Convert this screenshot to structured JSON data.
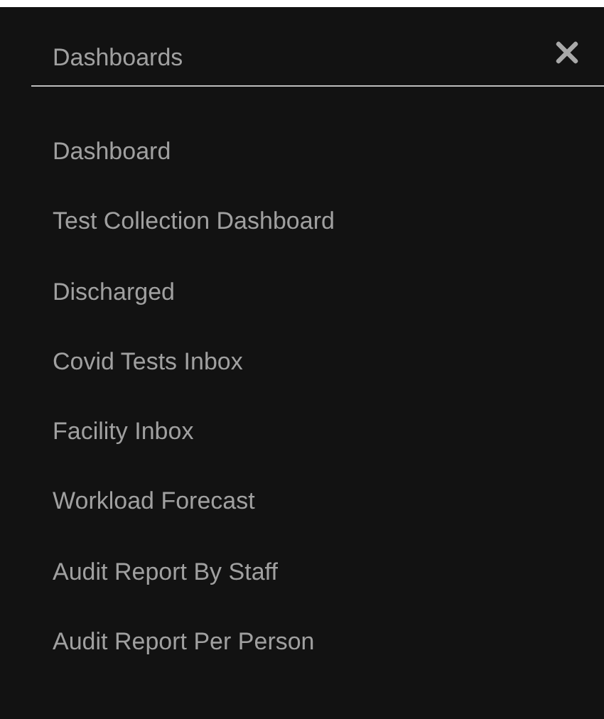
{
  "menu": {
    "title": "Dashboards",
    "items": [
      {
        "label": "Dashboard"
      },
      {
        "label": "Test Collection Dashboard"
      },
      {
        "label": "Discharged"
      },
      {
        "label": "Covid Tests Inbox"
      },
      {
        "label": "Facility Inbox"
      },
      {
        "label": "Workload Forecast"
      },
      {
        "label": "Audit Report By Staff"
      },
      {
        "label": "Audit Report Per Person"
      }
    ]
  }
}
